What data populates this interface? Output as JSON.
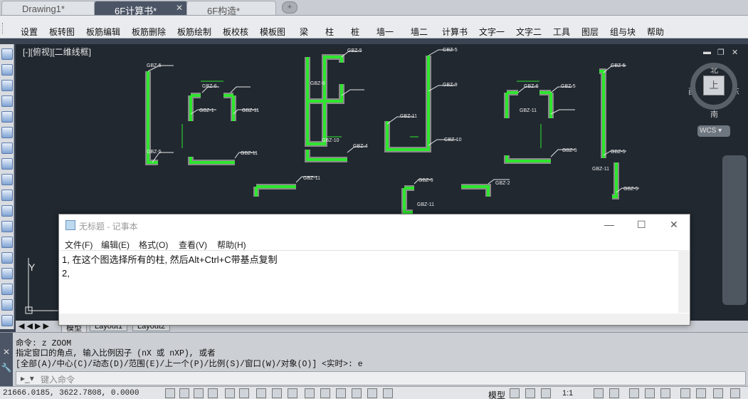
{
  "tabs": [
    {
      "label": "Drawing1*"
    },
    {
      "label": "6F计算书*"
    },
    {
      "label": "6F构造*"
    }
  ],
  "menu": [
    "设置",
    "板转图",
    "板筋编辑",
    "板筋删除",
    "板筋绘制",
    "板校核",
    "模板图",
    "梁",
    "柱",
    "桩",
    "墙一",
    "墙二",
    "计算书",
    "文字一",
    "文字二",
    "工具",
    "图层",
    "组与块",
    "帮助"
  ],
  "viewport": {
    "label": "[-][俯视][二维线框]"
  },
  "navcube": {
    "top": "上",
    "north": "北",
    "south": "南",
    "east": "东",
    "west": "西",
    "wcs": "WCS"
  },
  "column_labels": [
    "GBZ-5",
    "GBZ-6",
    "GBZ-9",
    "GBZ-1",
    "GBZ-11",
    "GBZ-10",
    "GBZ-4",
    "GBZ-2",
    "GBZ-5",
    "GBZ-11",
    "GBZ-5",
    "GBZ-11",
    "GBZ-5"
  ],
  "layout_tabs": [
    "模型",
    "Layout1",
    "Layout2"
  ],
  "command": {
    "lines": [
      "命令: z ZOOM",
      "指定窗口的角点, 输入比例因子 (nX 或 nXP), 或者",
      "[全部(A)/中心(C)/动态(D)/范围(E)/上一个(P)/比例(S)/窗口(W)/对象(O)] <实时>: e"
    ],
    "placeholder": "键入命令"
  },
  "status": {
    "coords": "21666.0185, 3622.7808, 0.0000",
    "model": "模型",
    "scale": "1:1"
  },
  "notepad": {
    "title": "无标题 - 记事本",
    "menu": [
      "文件(F)",
      "编辑(E)",
      "格式(O)",
      "查看(V)",
      "帮助(H)"
    ],
    "lines": [
      "1, 在这个图选择所有的柱, 然后Alt+Ctrl+C带基点复制",
      "2,"
    ]
  },
  "colors": {
    "column_fill": "#2ee62e",
    "column_outline": "#8a8a8a",
    "canvas_bg": "#212830"
  }
}
